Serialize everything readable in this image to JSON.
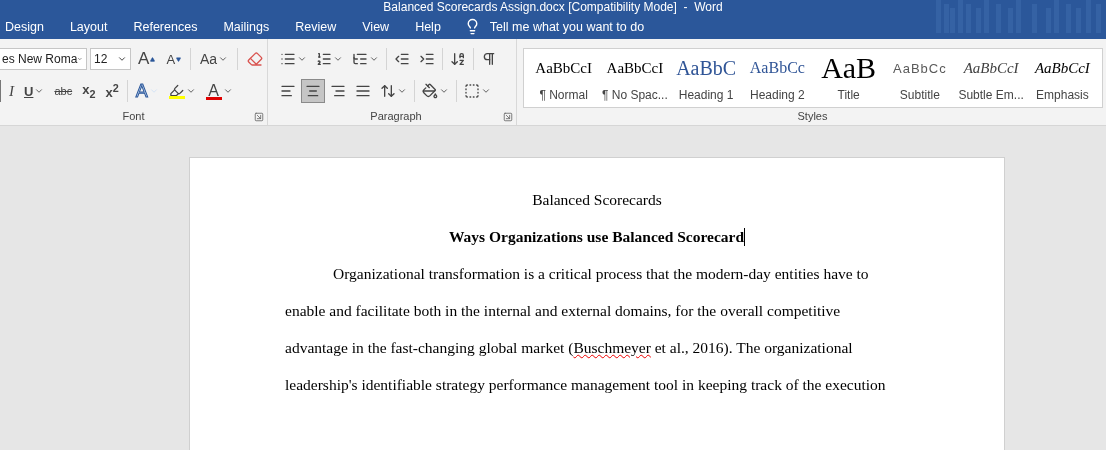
{
  "window": {
    "title": "Balanced Scorecards Assign.docx [Compatibility Mode]  -  Word"
  },
  "menu_tabs": [
    {
      "label": "Design"
    },
    {
      "label": "Layout"
    },
    {
      "label": "References"
    },
    {
      "label": "Mailings"
    },
    {
      "label": "Review"
    },
    {
      "label": "View"
    },
    {
      "label": "Help"
    }
  ],
  "tell_me": {
    "placeholder": "Tell me what you want to do"
  },
  "font_group": {
    "label": "Font",
    "font_name": "es New Roma",
    "font_size": "12",
    "row1": [
      {
        "kind": "grow",
        "text": "A"
      },
      {
        "kind": "shrink",
        "text": "A"
      },
      {
        "kind": "case",
        "text": "Aa"
      },
      {
        "kind": "clear"
      }
    ],
    "row2": [
      {
        "kind": "italic",
        "text": "I",
        "dropdown": false
      },
      {
        "kind": "underline",
        "text": "U",
        "dropdown": true
      },
      {
        "kind": "strike",
        "text": "abc",
        "dropdown": false
      },
      {
        "kind": "subscript",
        "text": "x$_{2}$",
        "dropdown": false
      },
      {
        "kind": "superscript",
        "text": "x$^{2}$",
        "dropdown": false
      },
      {
        "kind": "effects",
        "text": "A",
        "dropdown": true
      },
      {
        "kind": "highlight",
        "dropdown": true
      },
      {
        "kind": "color",
        "text": "A",
        "dropdown": true
      }
    ]
  },
  "paragraph_group": {
    "label": "Paragraph",
    "row1": [
      {
        "kind": "bullets",
        "dropdown": true
      },
      {
        "kind": "numbering",
        "dropdown": true
      },
      {
        "kind": "multilevel",
        "dropdown": true
      },
      {
        "kind": "outdent",
        "dropdown": false
      },
      {
        "kind": "indent",
        "dropdown": false
      },
      {
        "kind": "sort",
        "dropdown": false
      },
      {
        "kind": "marks",
        "dropdown": false
      }
    ],
    "alignments": [
      {
        "kind": "left",
        "selected": false
      },
      {
        "kind": "center",
        "selected": true
      },
      {
        "kind": "right",
        "selected": false
      },
      {
        "kind": "justify",
        "selected": false
      }
    ],
    "row2": [
      {
        "kind": "spacing",
        "dropdown": true
      },
      {
        "kind": "shading",
        "dropdown": true
      },
      {
        "kind": "borders",
        "dropdown": true
      }
    ]
  },
  "styles_group": {
    "label": "Styles",
    "items": [
      {
        "kind": "normal",
        "sample": "AaBbCcI",
        "label": "¶ Normal"
      },
      {
        "kind": "normal",
        "sample": "AaBbCcI",
        "label": "¶ No Spac..."
      },
      {
        "kind": "heading1",
        "sample": "AaBbC",
        "label": "Heading 1"
      },
      {
        "kind": "heading2",
        "sample": "AaBbCc",
        "label": "Heading 2"
      },
      {
        "kind": "title",
        "sample": "AaB",
        "label": "Title"
      },
      {
        "kind": "subtitle",
        "sample": "AaBbCc",
        "label": "Subtitle"
      },
      {
        "kind": "subtle",
        "sample": "AaBbCcI",
        "label": "Subtle Em..."
      },
      {
        "kind": "emphasis",
        "sample": "AaBbCcI",
        "label": "Emphasis"
      }
    ]
  },
  "document": {
    "title": "Balanced Scorecards",
    "heading": {
      "text": "Ways Organizations use Balanced Scorecard",
      "cursor": true
    },
    "lines": [
      {
        "indented": true,
        "segments": [
          {
            "text": "Organizational transformation is a critical process that the modern-day entities have to",
            "misspelled": false
          }
        ]
      },
      {
        "indented": false,
        "segments": [
          {
            "text": "enable and facilitate both in the internal and external domains, for the overall competitive",
            "misspelled": false
          }
        ]
      },
      {
        "indented": false,
        "segments": [
          {
            "text": "advantage in the fast-changing global market (",
            "misspelled": false
          },
          {
            "text": "Buschmeyer",
            "misspelled": true
          },
          {
            "text": " et al., 2016). The organizational",
            "misspelled": false
          }
        ]
      },
      {
        "indented": false,
        "segments": [
          {
            "text": "leadership's identifiable strategy performance management tool in keeping track of the execution",
            "misspelled": false
          }
        ]
      }
    ]
  }
}
